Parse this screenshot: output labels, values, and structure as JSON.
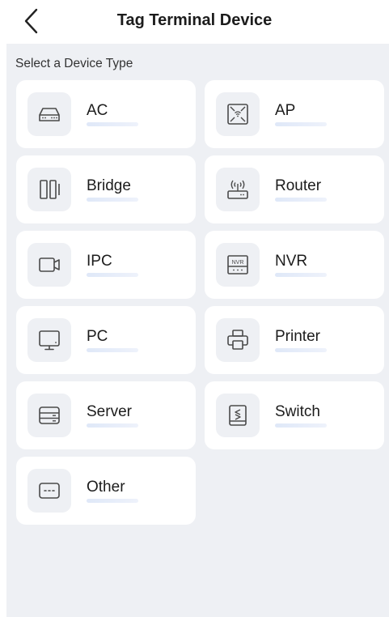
{
  "header": {
    "back_icon": "chevron-left-icon",
    "title": "Tag Terminal Device"
  },
  "main": {
    "section_label": "Select a Device Type",
    "devices": [
      {
        "label": "AC",
        "icon": "ac-controller-icon"
      },
      {
        "label": "AP",
        "icon": "access-point-icon"
      },
      {
        "label": "Bridge",
        "icon": "bridge-icon"
      },
      {
        "label": "Router",
        "icon": "router-icon"
      },
      {
        "label": "IPC",
        "icon": "ip-camera-icon"
      },
      {
        "label": "NVR",
        "icon": "nvr-icon",
        "icon_text": "NVR"
      },
      {
        "label": "PC",
        "icon": "monitor-icon"
      },
      {
        "label": "Printer",
        "icon": "printer-icon"
      },
      {
        "label": "Server",
        "icon": "server-icon"
      },
      {
        "label": "Switch",
        "icon": "switch-icon"
      },
      {
        "label": "Other",
        "icon": "more-icon"
      }
    ]
  },
  "colors": {
    "background": "#eef0f4",
    "card": "#ffffff",
    "icon_stroke": "#4a4a4a",
    "bar": "#dfe8f8"
  }
}
